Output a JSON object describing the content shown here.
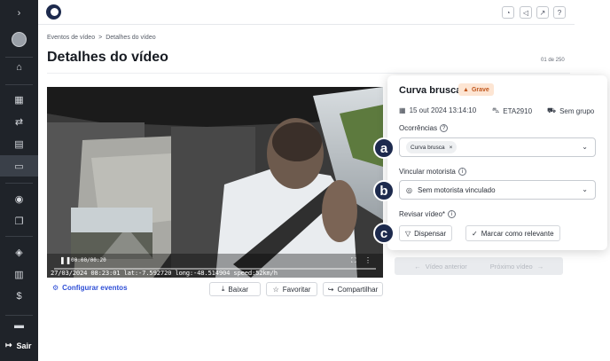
{
  "sidebar": {
    "expand_glyph": "›",
    "items": [
      {
        "icon": "home-icon",
        "glyph": "⌂"
      },
      {
        "icon": "map-icon",
        "glyph": "▦"
      },
      {
        "icon": "route-icon",
        "glyph": "⇄"
      },
      {
        "icon": "document-icon",
        "glyph": "▤"
      },
      {
        "icon": "video-icon",
        "glyph": "▭"
      },
      {
        "icon": "location-icon",
        "glyph": "◉"
      },
      {
        "icon": "copy-icon",
        "glyph": "❐"
      },
      {
        "icon": "shield-icon",
        "glyph": "◈"
      },
      {
        "icon": "bar-chart-icon",
        "glyph": "▥"
      },
      {
        "icon": "dollar-icon",
        "glyph": "$"
      },
      {
        "icon": "printer-icon",
        "glyph": "▬"
      }
    ],
    "exit_label": "Sair",
    "exit_glyph": "↦"
  },
  "topbar": {
    "buttons": [
      {
        "icon": "bell-icon",
        "glyph": "◔"
      },
      {
        "icon": "megaphone-icon",
        "glyph": "◁"
      },
      {
        "icon": "external-link-icon",
        "glyph": "↗"
      },
      {
        "icon": "help-icon",
        "glyph": "?"
      }
    ]
  },
  "breadcrumb": {
    "parent": "Eventos de vídeo",
    "separator": ">",
    "current": "Detalhes do vídeo"
  },
  "page": {
    "title": "Detalhes do vídeo",
    "pager": "01 de 250"
  },
  "video": {
    "time_display": "00:00/00:20",
    "overlay_text": "27/03/2024 08:23:01 lat:-7.592720 long:-48.514904 speed:52km/h",
    "progress": 0.0
  },
  "actions": {
    "configure_label": "Configurar eventos",
    "download_label": "Baixar",
    "favorite_label": "Favoritar",
    "share_label": "Compartilhar"
  },
  "occurrence": {
    "title": "Curva brusca",
    "severity_label": "Grave",
    "severity_glyph": "▲",
    "date": "15 out 2024 13:14:10",
    "vehicle": "ETA2910",
    "group": "Sem grupo",
    "occurrences_label": "Ocorrências",
    "occurrences_chip": "Curva brusca",
    "chip_remove": "×",
    "driver_label": "Vincular motorista",
    "driver_value": "Sem motorista vinculado",
    "review_label": "Revisar vídeo*",
    "dismiss_label": "Dispensar",
    "relevant_label": "Marcar como relevante",
    "info_glyph": "i",
    "help_glyph": "?",
    "chevron_glyph": "⌄"
  },
  "markers": {
    "a": "a",
    "b": "b",
    "c": "c"
  },
  "navigation": {
    "prev_label": "Vídeo anterior",
    "next_label": "Próximo vídeo",
    "prev_glyph": "←",
    "next_glyph": "→"
  },
  "colors": {
    "sidebar_bg": "#1f2329",
    "accent": "#2f4fd6",
    "marker": "#1d2a4d",
    "severity": "#c0561d"
  }
}
